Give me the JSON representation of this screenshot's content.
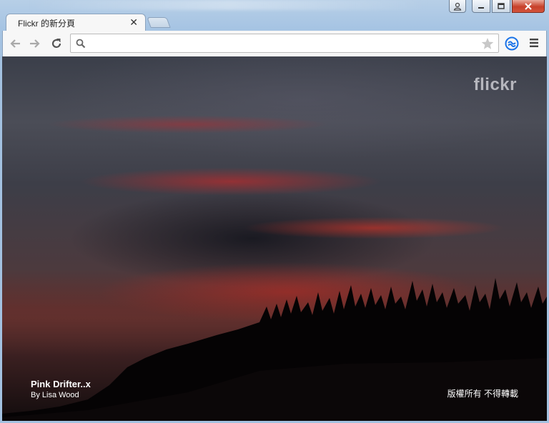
{
  "window": {
    "controls": {
      "user_icon": "user-icon",
      "minimize_icon": "minimize-icon",
      "maximize_icon": "maximize-icon",
      "close_icon": "close-icon",
      "close_color": "#c7402a"
    }
  },
  "tabs": [
    {
      "title": "Flickr 的新分頁",
      "active": true
    }
  ],
  "toolbar": {
    "back_icon": "back-arrow-icon",
    "forward_icon": "forward-arrow-icon",
    "reload_icon": "reload-icon",
    "omnibox": {
      "value": "",
      "search_icon": "search-icon",
      "star_icon": "star-icon"
    },
    "extension_icon": "sync-extension-icon",
    "menu_icon": "hamburger-menu-icon",
    "extension_color": "#1a73e8"
  },
  "page": {
    "logo": "flickr",
    "photo": {
      "title": "Pink Drifter..x",
      "author": "By Lisa Wood"
    },
    "copyright": "版權所有 不得轉載"
  }
}
